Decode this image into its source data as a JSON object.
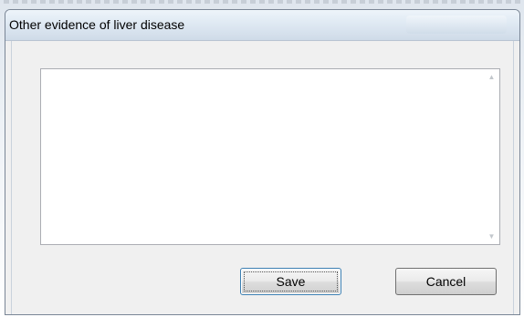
{
  "dialog": {
    "title": "Other evidence of liver disease"
  },
  "text_area": {
    "value": ""
  },
  "buttons": {
    "save_label": "Save",
    "cancel_label": "Cancel"
  },
  "icons": {
    "scroll_up": "scroll-up-arrow-icon",
    "scroll_down": "scroll-down-arrow-icon"
  },
  "colors": {
    "window_bg": "#f0f0f0",
    "title_bar": "#dfe9f3",
    "focus_border": "#3c7fb1"
  }
}
